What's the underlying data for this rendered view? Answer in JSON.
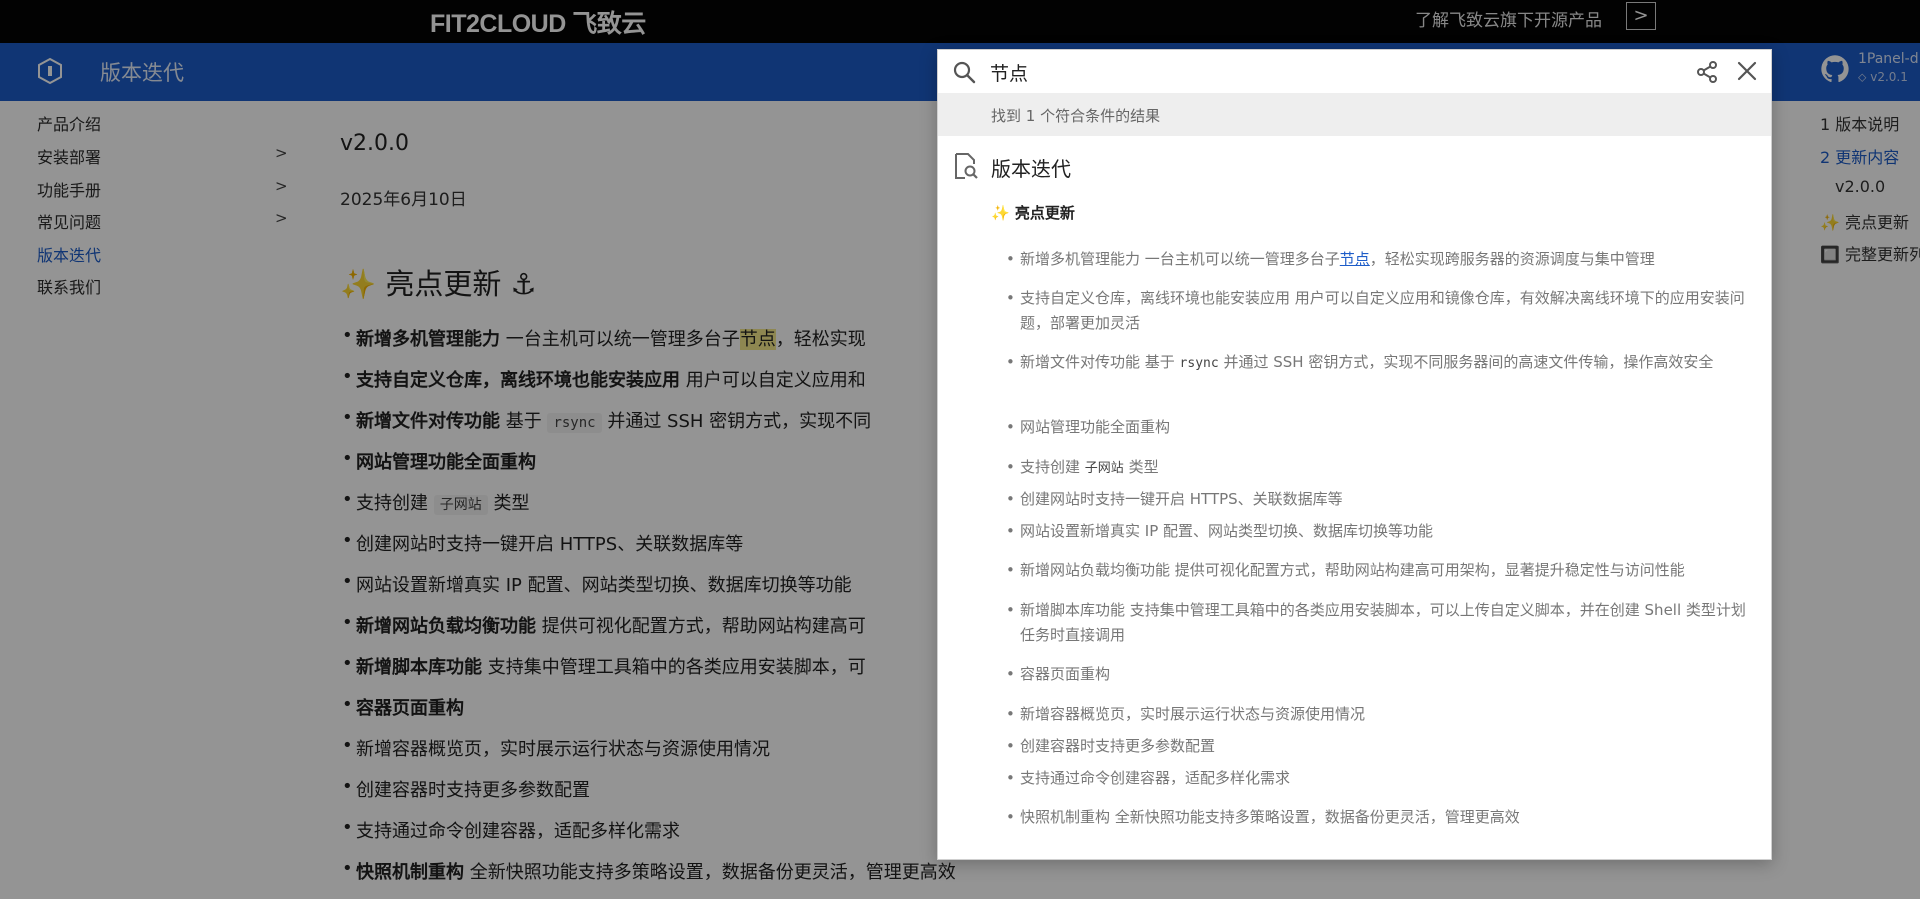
{
  "banner": {
    "brand": "FIT2CLOUD 飞致云",
    "promo": "了解飞致云旗下开源产品",
    "promo_btn": ">"
  },
  "header": {
    "title": "版本迭代",
    "repo_name": "1Panel-d",
    "repo_version": "v2.0.1"
  },
  "sidebar": {
    "items": [
      {
        "label": "产品介绍"
      },
      {
        "label": "安装部署",
        "chev": ">"
      },
      {
        "label": "功能手册",
        "chev": ">"
      },
      {
        "label": "常见问题",
        "chev": ">"
      },
      {
        "label": "版本迭代"
      },
      {
        "label": "联系我们"
      }
    ]
  },
  "main": {
    "version": "v2.0.0",
    "date": "2025年6月10日",
    "heading": "✨ 亮点更新 ⚓",
    "bullets": [
      {
        "bold": "新增多机管理能力",
        "pre": " 一台主机可以统一管理多台子",
        "hl": "节点",
        "post": "，轻松实现"
      },
      {
        "bold": "支持自定义仓库，离线环境也能安装应用",
        "text": " 用户可以自定义应用和"
      },
      {
        "bold": "新增文件对传功能",
        "pre": " 基于 ",
        "code": "rsync",
        "post": " 并通过 SSH 密钥方式，实现不同"
      },
      {
        "bold": "网站管理功能全面重构"
      },
      {
        "pre": "支持创建 ",
        "code": "子网站",
        "post": " 类型"
      },
      {
        "text": "创建网站时支持一键开启 HTTPS、关联数据库等"
      },
      {
        "text": "网站设置新增真实 IP 配置、网站类型切换、数据库切换等功能"
      },
      {
        "bold": "新增网站负载均衡功能",
        "text": " 提供可视化配置方式，帮助网站构建高可"
      },
      {
        "bold": "新增脚本库功能",
        "text": " 支持集中管理工具箱中的各类应用安装脚本，可"
      },
      {
        "bold": "容器页面重构"
      },
      {
        "text": "新增容器概览页，实时展示运行状态与资源使用情况"
      },
      {
        "text": "创建容器时支持更多参数配置"
      },
      {
        "text": "支持通过命令创建容器，适配多样化需求"
      },
      {
        "bold": "快照机制重构",
        "text": " 全新快照功能支持多策略设置，数据备份更灵活，管理更高效"
      }
    ]
  },
  "toc": {
    "items": [
      {
        "label": "1 版本说明"
      },
      {
        "label": "2 更新内容"
      },
      {
        "label": "v2.0.0"
      },
      {
        "label": "✨ 亮点更新"
      },
      {
        "label": "🔲 完整更新列"
      }
    ]
  },
  "search": {
    "query": "节点",
    "count_text": "找到 1 个符合条件的结果",
    "group_title": "版本迭代",
    "sub_title": "✨ 亮点更新",
    "results": [
      {
        "pre": "新增多机管理能力 一台主机可以统一管理多台子",
        "match": "节点",
        "post": "，轻松实现跨服务器的资源调度与集中管理"
      },
      {
        "text": "支持自定义仓库，离线环境也能安装应用 用户可以自定义应用和镜像仓库，有效解决离线环境下的应用安装问题，部署更加灵活"
      },
      {
        "pre": "新增文件对传功能 基于 ",
        "code": "rsync",
        "post": " 并通过 SSH 密钥方式，实现不同服务器间的高速文件传输，操作高效安全"
      },
      {
        "text": "网站管理功能全面重构"
      },
      {
        "pre": "支持创建 ",
        "code": "子网站",
        "post": " 类型"
      },
      {
        "text": "创建网站时支持一键开启 HTTPS、关联数据库等"
      },
      {
        "text": "网站设置新增真实 IP 配置、网站类型切换、数据库切换等功能"
      },
      {
        "text": "新增网站负载均衡功能 提供可视化配置方式，帮助网站构建高可用架构，显著提升稳定性与访问性能"
      },
      {
        "text": "新增脚本库功能 支持集中管理工具箱中的各类应用安装脚本，可以上传自定义脚本，并在创建 Shell 类型计划任务时直接调用"
      },
      {
        "text": "容器页面重构"
      },
      {
        "text": "新增容器概览页，实时展示运行状态与资源使用情况"
      },
      {
        "text": "创建容器时支持更多参数配置"
      },
      {
        "text": "支持通过命令创建容器，适配多样化需求"
      },
      {
        "text": "快照机制重构 全新快照功能支持多策略设置，数据备份更灵活，管理更高效"
      }
    ]
  },
  "colors": {
    "header": "#1d5cc8",
    "banner": "#050505",
    "highlight": "#f4e98c",
    "link": "#1d5cc8"
  }
}
